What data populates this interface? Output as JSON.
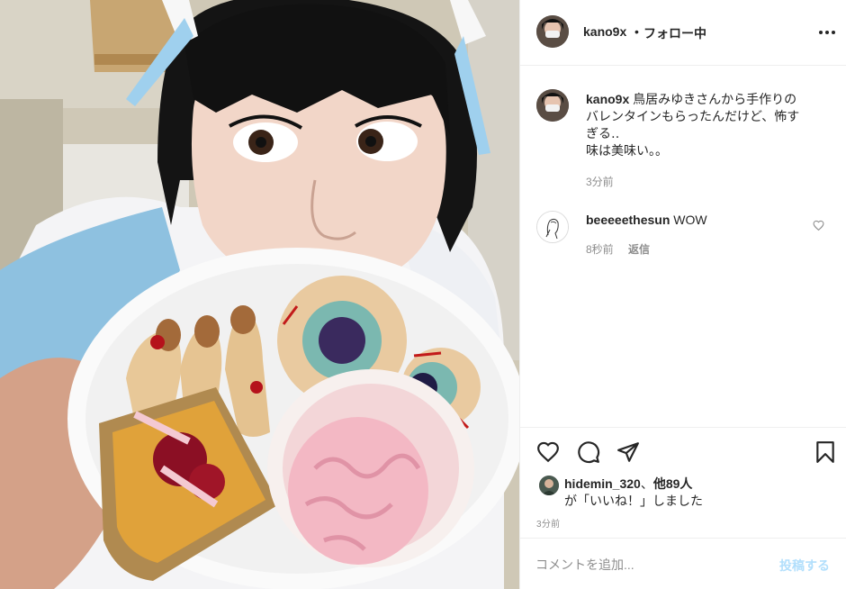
{
  "header": {
    "username": "kano9x",
    "separator": "•",
    "follow_status": "フォロー中",
    "more_icon": "more-horizontal-icon"
  },
  "caption": {
    "username": "kano9x",
    "text_line1": "鳥居みゆきさんから手作りの",
    "text_line2": "バレンタインもらったんだけど、怖す",
    "text_line3": "ぎる‥",
    "text_line4": "味は美味い。。",
    "time": "3分前"
  },
  "reply_comment": {
    "username": "beeeeethesun",
    "text": "WOW",
    "time": "8秒前",
    "reply_label": "返信",
    "like_icon": "heart-outline-icon"
  },
  "actions": {
    "icons": [
      "heart-icon",
      "comment-icon",
      "share-icon",
      "bookmark-icon"
    ]
  },
  "likes": {
    "user": "hidemin_320",
    "separator": "、",
    "others": "他89人",
    "suffix": "が「いいね！」しました"
  },
  "post_time": "3分前",
  "comment_box": {
    "placeholder": "コメントを追加...",
    "post_label": "投稿する",
    "post_color": "#b2dffc"
  },
  "colors": {
    "text": "#262626",
    "secondary": "#8e8e8e",
    "border": "#efefef"
  }
}
